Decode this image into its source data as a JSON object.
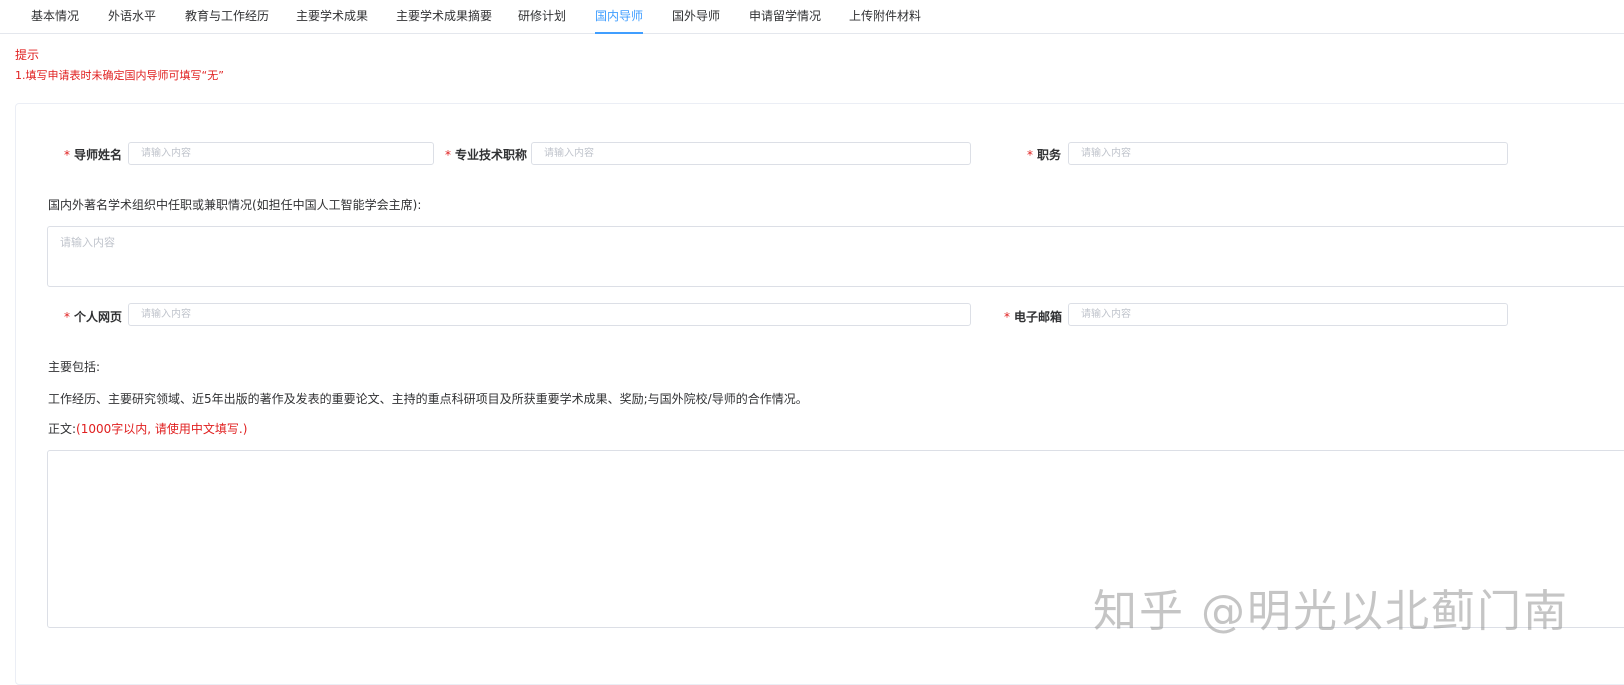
{
  "tabs": [
    {
      "label": "基本情况",
      "active": false
    },
    {
      "label": "外语水平",
      "active": false
    },
    {
      "label": "教育与工作经历",
      "active": false
    },
    {
      "label": "主要学术成果",
      "active": false
    },
    {
      "label": "主要学术成果摘要",
      "active": false
    },
    {
      "label": "研修计划",
      "active": false
    },
    {
      "label": "国内导师",
      "active": true
    },
    {
      "label": "国外导师",
      "active": false
    },
    {
      "label": "申请留学情况",
      "active": false
    },
    {
      "label": "上传附件材料",
      "active": false
    }
  ],
  "hint": {
    "title": "提示",
    "text": "1.填写申请表时未确定国内导师可填写“无”"
  },
  "form": {
    "required_mark": "*",
    "placeholder": "请输入内容",
    "tutor_name": {
      "label": "导师姓名",
      "value": ""
    },
    "title": {
      "label": "专业技术职称",
      "value": ""
    },
    "position": {
      "label": "职务",
      "value": ""
    },
    "org_label": "国内外著名学术组织中任职或兼职情况(如担任中国人工智能学会主席):",
    "org_value": "",
    "homepage": {
      "label": "个人网页",
      "value": ""
    },
    "email": {
      "label": "电子邮箱",
      "value": ""
    },
    "main_includes": "主要包括:",
    "main_desc": "工作经历、主要研究领域、近5年出版的著作及发表的重要论文、主持的重点科研项目及所获重要学术成果、奖励;与国外院校/导师的合作情况。",
    "body_label": "正文:",
    "body_note": "(1000字以内, 请使用中文填写.)",
    "body_value": ""
  },
  "watermark": "知乎 @明光以北蓟门南",
  "colors": {
    "accent": "#409eff",
    "required": "#e02020",
    "border": "#dcdfe6"
  }
}
